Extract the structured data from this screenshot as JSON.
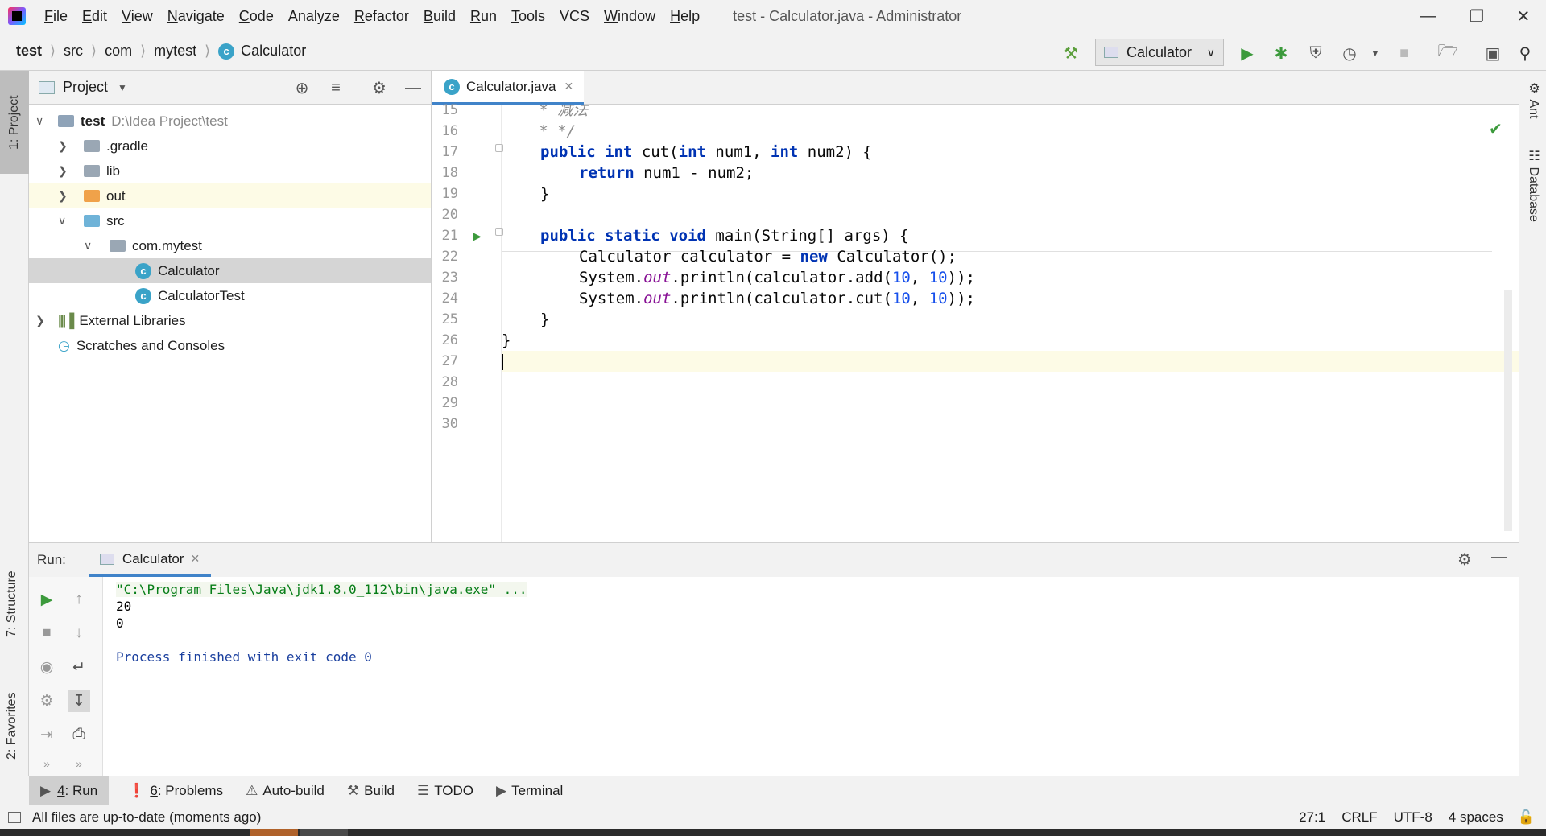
{
  "menubar": {
    "items": [
      {
        "label": "File",
        "u": "F",
        "rest": "ile"
      },
      {
        "label": "Edit",
        "u": "E",
        "rest": "dit"
      },
      {
        "label": "View",
        "u": "V",
        "rest": "iew"
      },
      {
        "label": "Navigate",
        "u": "N",
        "rest": "avigate"
      },
      {
        "label": "Code",
        "u": "C",
        "rest": "ode"
      },
      {
        "label": "Analyze",
        "u": "",
        "rest": "Analyze"
      },
      {
        "label": "Refactor",
        "u": "R",
        "rest": "efactor"
      },
      {
        "label": "Build",
        "u": "B",
        "rest": "uild"
      },
      {
        "label": "Run",
        "u": "R",
        "rest": "un"
      },
      {
        "label": "Tools",
        "u": "T",
        "rest": "ools"
      },
      {
        "label": "VCS",
        "u": "",
        "rest": "VCS"
      },
      {
        "label": "Window",
        "u": "W",
        "rest": "indow"
      },
      {
        "label": "Help",
        "u": "H",
        "rest": "elp"
      }
    ],
    "window_title": "test - Calculator.java - Administrator"
  },
  "breadcrumb": [
    "test",
    "src",
    "com",
    "mytest",
    "Calculator"
  ],
  "toolbar": {
    "run_config": "Calculator"
  },
  "left_strip": {
    "project": "1: Project",
    "structure": "7: Structure",
    "favorites": "2: Favorites"
  },
  "right_strip": {
    "ant": "Ant",
    "database": "Database"
  },
  "project": {
    "header": "Project",
    "tree": [
      {
        "label": "test",
        "path": "D:\\Idea Project\\test"
      },
      {
        "label": ".gradle"
      },
      {
        "label": "lib"
      },
      {
        "label": "out"
      },
      {
        "label": "src"
      },
      {
        "label": "com.mytest"
      },
      {
        "label": "Calculator"
      },
      {
        "label": "CalculatorTest"
      },
      {
        "label": "External Libraries"
      },
      {
        "label": "Scratches and Consoles"
      }
    ]
  },
  "editor": {
    "tab": "Calculator.java",
    "line_numbers": [
      "15",
      "16",
      "17",
      "18",
      "19",
      "20",
      "21",
      "22",
      "23",
      "24",
      "25",
      "26",
      "27",
      "28",
      "29",
      "30"
    ],
    "lines": {
      "l15": "   * 减法",
      "l16": "   * */",
      "l17_kw1": "public",
      "l17_kw2": "int",
      "l17_a": " cut(",
      "l17_kw3": "int",
      "l17_b": " num1, ",
      "l17_kw4": "int",
      "l17_c": " num2) {",
      "l18_kw": "return",
      "l18_a": " num1 - num2;",
      "l19": "}",
      "l21_kw1": "public",
      "l21_kw2": "static",
      "l21_kw3": "void",
      "l21_a": " main(String[] args) {",
      "l22_a": "Calculator calculator = ",
      "l22_kw": "new",
      "l22_b": " Calculator();",
      "l23_a": "System.",
      "l23_f": "out",
      "l23_b": ".println(calculator.add(",
      "l23_n1": "10",
      "l23_c": ", ",
      "l23_n2": "10",
      "l23_d": "));",
      "l24_a": "System.",
      "l24_f": "out",
      "l24_b": ".println(calculator.cut(",
      "l24_n1": "10",
      "l24_c": ", ",
      "l24_n2": "10",
      "l24_d": "));",
      "l25": "}",
      "l26": "}"
    }
  },
  "run": {
    "label": "Run:",
    "tab": "Calculator",
    "output": {
      "cmd": "\"C:\\Program Files\\Java\\jdk1.8.0_112\\bin\\java.exe\" ...",
      "line1": "20",
      "line2": "0",
      "finish": "Process finished with exit code 0"
    }
  },
  "bottom_tabs": [
    {
      "num": "4",
      "label": ": Run"
    },
    {
      "num": "6",
      "label": ": Problems"
    },
    {
      "label": "Auto-build"
    },
    {
      "label": "Build"
    },
    {
      "label": "TODO"
    },
    {
      "label": "Terminal"
    }
  ],
  "status": {
    "message": "All files are up-to-date (moments ago)",
    "position": "27:1",
    "line_sep": "CRLF",
    "encoding": "UTF-8",
    "indent": "4 spaces"
  }
}
